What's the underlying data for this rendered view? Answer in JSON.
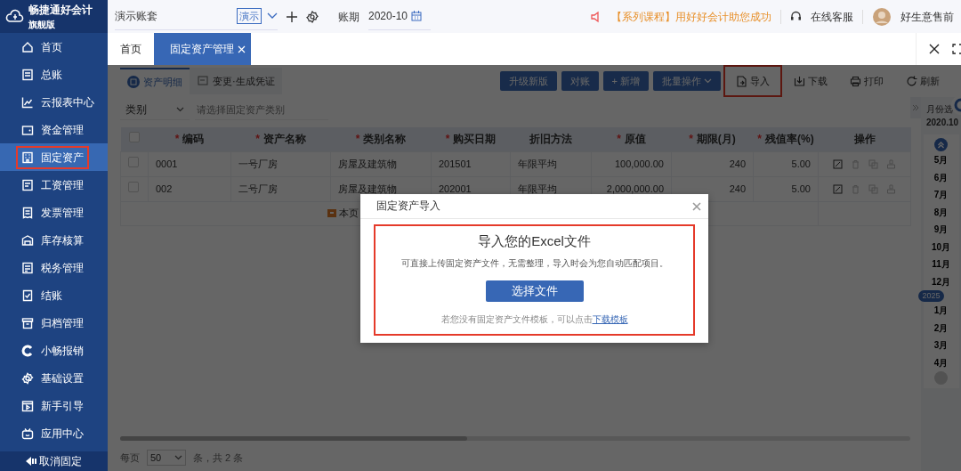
{
  "app": {
    "name": "畅捷通好会计",
    "edition": "旗舰版"
  },
  "sidebar": {
    "items": [
      {
        "label": "首页",
        "selected": false,
        "highlighted": false
      },
      {
        "label": "总账",
        "selected": false,
        "highlighted": false
      },
      {
        "label": "云报表中心",
        "selected": false,
        "highlighted": false
      },
      {
        "label": "资金管理",
        "selected": false,
        "highlighted": false
      },
      {
        "label": "固定资产",
        "selected": true,
        "highlighted": true
      },
      {
        "label": "工资管理",
        "selected": false,
        "highlighted": false
      },
      {
        "label": "发票管理",
        "selected": false,
        "highlighted": false
      },
      {
        "label": "库存核算",
        "selected": false,
        "highlighted": false
      },
      {
        "label": "税务管理",
        "selected": false,
        "highlighted": false
      },
      {
        "label": "结账",
        "selected": false,
        "highlighted": false
      },
      {
        "label": "归档管理",
        "selected": false,
        "highlighted": false
      },
      {
        "label": "小畅报销",
        "selected": false,
        "highlighted": false
      },
      {
        "label": "基础设置",
        "selected": false,
        "highlighted": false
      },
      {
        "label": "新手引导",
        "selected": false,
        "highlighted": false
      },
      {
        "label": "应用中心",
        "selected": false,
        "highlighted": false
      }
    ],
    "unpin": "取消固定"
  },
  "header": {
    "account_set": "演示账套",
    "account_badge": "演示",
    "period_label": "账期",
    "period": "2020-10",
    "notice": "【系列课程】用好好会计助您成功",
    "support": "在线客服",
    "user": "好生意售前"
  },
  "tabs": [
    {
      "label": "首页",
      "selected": false,
      "closable": false
    },
    {
      "label": "固定资产管理",
      "selected": true,
      "closable": true
    }
  ],
  "sub_tabs": [
    {
      "label": "资产明细",
      "selected": true
    },
    {
      "label": "变更·生成凭证",
      "selected": false
    }
  ],
  "toolbar": [
    {
      "label": "升级新版",
      "kind": "primary",
      "highlighted": false
    },
    {
      "label": "对账",
      "kind": "primary",
      "highlighted": false
    },
    {
      "label": "+ 新增",
      "kind": "primary",
      "highlighted": false
    },
    {
      "label": "批量操作",
      "kind": "dropdown",
      "highlighted": false
    },
    {
      "label": "导入",
      "kind": "import",
      "highlighted": true
    },
    {
      "label": "下载",
      "kind": "download",
      "highlighted": false
    },
    {
      "label": "打印",
      "kind": "print",
      "highlighted": false
    },
    {
      "label": "刷新",
      "kind": "refresh",
      "highlighted": false
    }
  ],
  "filter": {
    "field": "类别",
    "placeholder": "请选择固定资产类别"
  },
  "table": {
    "all_checked": false,
    "columns": [
      {
        "label": "编码",
        "mark": "*"
      },
      {
        "label": "资产名称",
        "mark": "*"
      },
      {
        "label": "类别名称",
        "mark": "*"
      },
      {
        "label": "购买日期",
        "mark": "*"
      },
      {
        "label": "折旧方法"
      },
      {
        "label": "原值",
        "mark": "*"
      },
      {
        "label": "期限(月)",
        "mark": "*"
      },
      {
        "label": "残值率(%)",
        "mark": "*"
      },
      {
        "label": "操作"
      }
    ],
    "rows": [
      {
        "checked": false,
        "cells": [
          "0001",
          "一号厂房",
          "房屋及建筑物",
          "201501",
          "年限平均",
          "100,000.00",
          "240",
          "5.00"
        ]
      },
      {
        "checked": false,
        "cells": [
          "002",
          "二号厂房",
          "房屋及建筑物",
          "202001",
          "年限平均",
          "2,000,000.00",
          "240",
          "5.00"
        ]
      }
    ],
    "footer": "本页"
  },
  "pagination": {
    "label": "每页",
    "size": "50",
    "summary": "条，共 2 条"
  },
  "month_panel": {
    "title": "月份选",
    "current": "2020.10",
    "items": [
      {
        "label": "5月",
        "kind": "month"
      },
      {
        "label": "6月",
        "kind": "month"
      },
      {
        "label": "7月",
        "kind": "month"
      },
      {
        "label": "8月",
        "kind": "month"
      },
      {
        "label": "9月",
        "kind": "month"
      },
      {
        "label": "10月",
        "kind": "month"
      },
      {
        "label": "11月",
        "kind": "month"
      },
      {
        "label": "12月",
        "kind": "month"
      },
      {
        "label": "2025",
        "kind": "year"
      },
      {
        "label": "1月",
        "kind": "month"
      },
      {
        "label": "2月",
        "kind": "month"
      },
      {
        "label": "3月",
        "kind": "month"
      },
      {
        "label": "4月",
        "kind": "month"
      }
    ]
  },
  "dialog": {
    "title": "固定资产导入",
    "heading": "导入您的Excel文件",
    "description": "可直接上传固定资产文件，无需整理，导入时会为您自动匹配项目。",
    "button": "选择文件",
    "hint": "若您没有固定资产文件模板，可以点击",
    "link": "下载模板",
    "highlighted": true
  }
}
